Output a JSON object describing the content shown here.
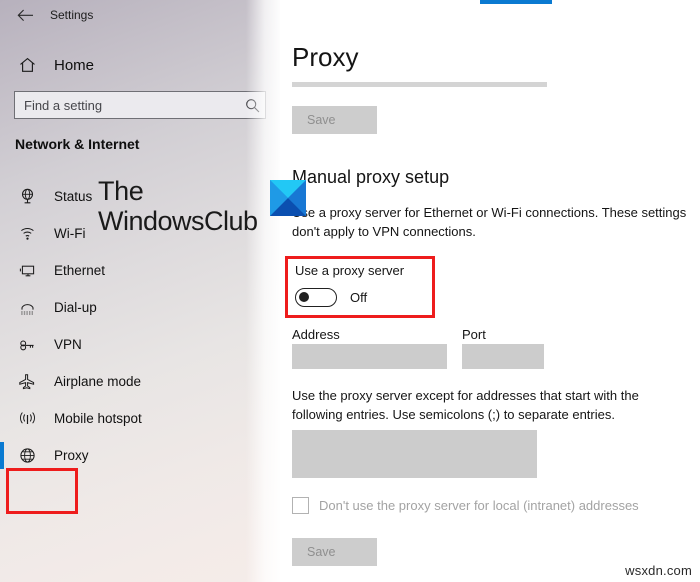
{
  "titlebar": {
    "back_icon": "back-arrow-icon",
    "title": "Settings"
  },
  "sidebar": {
    "home": {
      "icon": "home-icon",
      "label": "Home"
    },
    "search": {
      "icon": "search-icon",
      "placeholder": "Find a setting",
      "value": ""
    },
    "section_title": "Network & Internet",
    "items": [
      {
        "icon": "globe-status-icon",
        "label": "Status",
        "selected": false
      },
      {
        "icon": "wifi-icon",
        "label": "Wi-Fi",
        "selected": false
      },
      {
        "icon": "ethernet-icon",
        "label": "Ethernet",
        "selected": false
      },
      {
        "icon": "dialup-phone-icon",
        "label": "Dial-up",
        "selected": false
      },
      {
        "icon": "vpn-key-icon",
        "label": "VPN",
        "selected": false
      },
      {
        "icon": "airplane-icon",
        "label": "Airplane mode",
        "selected": false
      },
      {
        "icon": "mobile-hotspot-icon",
        "label": "Mobile hotspot",
        "selected": false
      },
      {
        "icon": "proxy-globe-icon",
        "label": "Proxy",
        "selected": true
      }
    ]
  },
  "watermark": {
    "line1": "The",
    "line2": "WindowsClub",
    "logo_icon": "windowsclub-logo-icon"
  },
  "main": {
    "page_title": "Proxy",
    "save_top_label": "Save",
    "section_heading": "Manual proxy setup",
    "description": "Use a proxy server for Ethernet or Wi-Fi connections. These settings don't apply to VPN connections.",
    "toggle": {
      "label": "Use a proxy server",
      "state": "Off",
      "on": false
    },
    "address": {
      "label": "Address",
      "value": ""
    },
    "port": {
      "label": "Port",
      "value": ""
    },
    "exceptions": {
      "description": "Use the proxy server except for addresses that start with the following entries. Use semicolons (;) to separate entries.",
      "value": ""
    },
    "local_checkbox": {
      "label": "Don't use the proxy server for local (intranet) addresses",
      "checked": false
    },
    "save_bottom_label": "Save"
  },
  "annotations": {
    "color": "#ee1c1c",
    "boxes": [
      "proxy-nav-item",
      "use-a-proxy-server-toggle"
    ]
  },
  "footer_watermark": "wsxdn.com",
  "colors": {
    "accent_blue": "#0a7ad1",
    "annotation_red": "#ee1c1c",
    "disabled_gray": "#cccccc"
  }
}
